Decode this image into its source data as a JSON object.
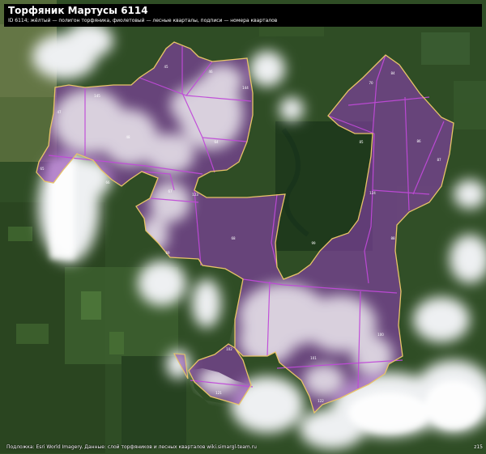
{
  "header": {
    "title": "Торфяник Мартусы 6114",
    "subtitle": "ID 6114; жёлтый — полигон торфяника, фиолетовый — лесные кварталы, подписи — номера кварталов"
  },
  "footer": {
    "attribution": "Подложка: Esri World Imagery. Данные: слой торфяников и лесных кварталов wiki.simargl-team.ru",
    "zoom": "z15"
  },
  "colors": {
    "peatland_outline": "#e8c468",
    "quarter_fill": "#8a3fae",
    "quarter_line": "#c04ad8",
    "forest": "#2c4a22",
    "cloud": "#e8e8e8"
  },
  "quarter_labels": [
    "45",
    "46",
    "47",
    "48",
    "64",
    "65",
    "66",
    "67",
    "68",
    "69",
    "70",
    "84",
    "85",
    "86",
    "87",
    "88",
    "99",
    "100",
    "101",
    "102",
    "121",
    "122",
    "123",
    "124",
    "144",
    "145"
  ]
}
